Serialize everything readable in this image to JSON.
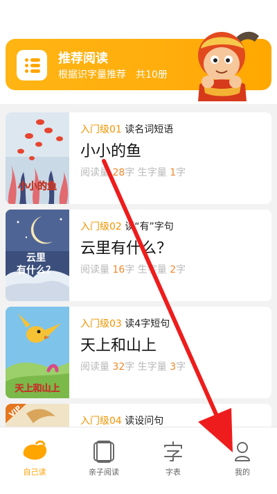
{
  "banner": {
    "title": "推荐阅读",
    "subtitle": "根据识字量推荐　共10册",
    "icon": "list-icon",
    "mascot": "monkey-king-mascot"
  },
  "books": [
    {
      "level": "入门级01",
      "desc": "读名词短语",
      "title": "小小的鱼",
      "cover_text": "小小的鱼",
      "read_label": "阅读量",
      "read_count": "28",
      "new_label": "生字量",
      "new_count": "1",
      "unit": "字"
    },
    {
      "level": "入门级02",
      "desc": "读“有”字句",
      "title": "云里有什么？",
      "cover_text": "云里有什么？",
      "read_label": "阅读量",
      "read_count": "16",
      "new_label": "生字量",
      "new_count": "2",
      "unit": "字"
    },
    {
      "level": "入门级03",
      "desc": "读4字短句",
      "title": "天上和山上",
      "cover_text": "天上和山上",
      "read_label": "阅读量",
      "read_count": "32",
      "new_label": "生字量",
      "new_count": "3",
      "unit": "字"
    },
    {
      "level": "入门级04",
      "desc": "读设问句",
      "title": "",
      "cover_text": "",
      "badge": "VIP",
      "read_label": "",
      "read_count": "",
      "new_label": "",
      "new_count": "",
      "unit": ""
    }
  ],
  "tabs": [
    {
      "label": "自己读",
      "icon": "self-read-icon",
      "active": true
    },
    {
      "label": "亲子阅读",
      "icon": "parent-child-read-icon",
      "active": false
    },
    {
      "label": "字表",
      "icon": "character-table-icon",
      "active": false
    },
    {
      "label": "我的",
      "icon": "profile-icon",
      "active": false
    }
  ],
  "colors": {
    "accent": "#ffa500",
    "level": "#f29400",
    "number": "#f0882a",
    "annotation_arrow": "#ee1c1c"
  }
}
